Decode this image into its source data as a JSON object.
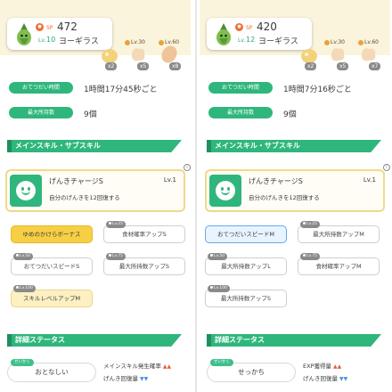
{
  "panels": [
    {
      "level_badge": "",
      "cp_label": "SP",
      "cp": "472",
      "level_label": "Lv.",
      "level": "10",
      "name": "ヨーギラス",
      "items": [
        {
          "lv": "Lv.30",
          "count": "x2"
        },
        {
          "lv": "Lv.30",
          "count": "x5"
        },
        {
          "lv": "Lv.60",
          "count": "x8"
        }
      ],
      "help_interval_label": "おてつだい時間",
      "help_interval": "1時間17分45秒ごと",
      "max_hold_label": "最大所持数",
      "max_hold": "9個",
      "main_skill_section": "メインスキル・サブスキル",
      "main_skill_name": "げんきチャージS",
      "main_skill_level": "Lv.1",
      "main_skill_desc": "自分のげんきを12回復する",
      "subskills": [
        {
          "label": "ゆめのかけらボーナス",
          "tag": ""
        },
        {
          "label": "食材確率アップS",
          "tag": "Lv.25"
        },
        {
          "label": "おてつだいスピードS",
          "tag": "Lv.50"
        },
        {
          "label": "最大所持数アップS",
          "tag": "Lv.75"
        },
        {
          "label": "スキルレベルアップM",
          "tag": "Lv.100"
        }
      ],
      "detail_section": "詳細ステータス",
      "nature_label": "せいかく",
      "nature": "おとなしい",
      "modifiers": [
        {
          "label": "メインスキル発生確率",
          "arrows": "▲▲"
        },
        {
          "label": "げんき回復量",
          "arrows": "▼▼"
        }
      ]
    },
    {
      "level_badge": "",
      "cp_label": "SP",
      "cp": "420",
      "level_label": "Lv.",
      "level": "12",
      "name": "ヨーギラス",
      "items": [
        {
          "lv": "Lv.30",
          "count": "x2"
        },
        {
          "lv": "Lv.30",
          "count": "x5"
        },
        {
          "lv": "Lv.60",
          "count": "x7"
        }
      ],
      "help_interval_label": "おてつだい時間",
      "help_interval": "1時間7分16秒ごと",
      "max_hold_label": "最大所持数",
      "max_hold": "9個",
      "main_skill_section": "メインスキル・サブスキル",
      "main_skill_name": "げんきチャージS",
      "main_skill_level": "Lv.1",
      "main_skill_desc": "自分のげんきを12回復する",
      "subskills": [
        {
          "label": "おてつだいスピードM",
          "tag": ""
        },
        {
          "label": "最大所持数アップM",
          "tag": "Lv.25"
        },
        {
          "label": "最大所持数アップL",
          "tag": "Lv.50"
        },
        {
          "label": "食材確率アップM",
          "tag": "Lv.75"
        },
        {
          "label": "最大所持数アップS",
          "tag": "Lv.100"
        }
      ],
      "detail_section": "詳細ステータス",
      "nature_label": "せいかく",
      "nature": "せっかち",
      "modifiers": [
        {
          "label": "EXP獲得量",
          "arrows": "▲▲"
        },
        {
          "label": "げんき回復量",
          "arrows": "▼▼"
        }
      ]
    }
  ],
  "colors": {
    "accent_green": "#2fb67c",
    "gold": "#f7cf45",
    "blue_highlight": "#68a8e8",
    "cp_orange": "#f26c32",
    "up_arrow": "#e2603a",
    "down_arrow": "#4a90d9"
  },
  "icons": [
    "sprite-yogiras",
    "sp-icon",
    "berry-item-icon",
    "ingredient-item-icon",
    "lock-icon",
    "smile-skill-icon",
    "info-icon",
    "up-arrow-icon",
    "down-arrow-icon"
  ]
}
